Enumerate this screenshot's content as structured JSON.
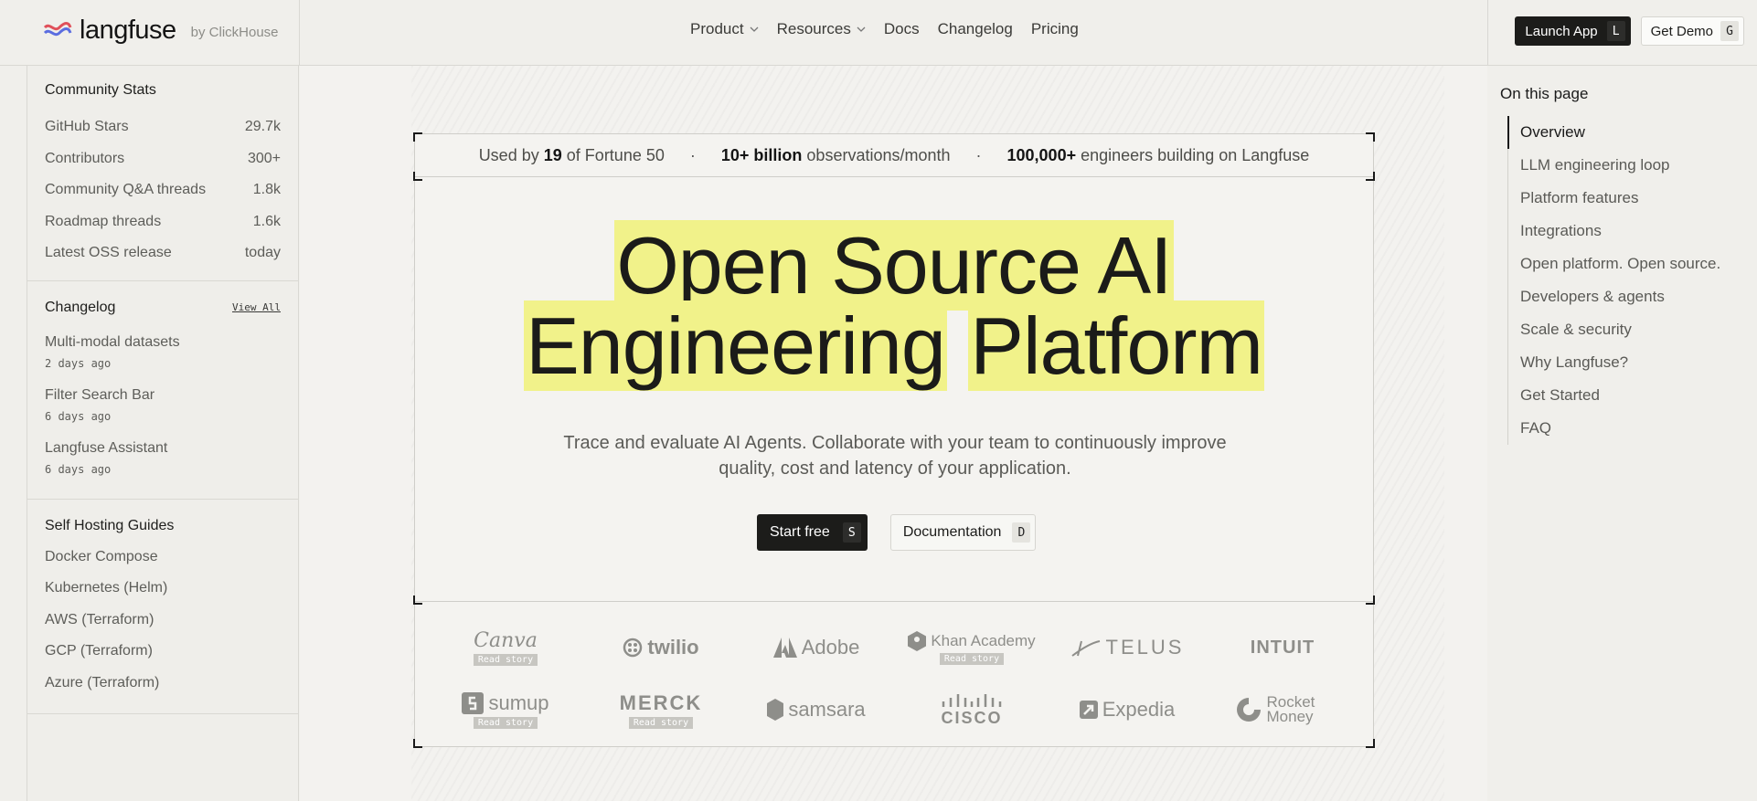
{
  "brand": {
    "name": "langfuse",
    "byline": "by ClickHouse"
  },
  "nav": {
    "items": [
      {
        "label": "Product",
        "dropdown": true
      },
      {
        "label": "Resources",
        "dropdown": true
      },
      {
        "label": "Docs",
        "dropdown": false
      },
      {
        "label": "Changelog",
        "dropdown": false
      },
      {
        "label": "Pricing",
        "dropdown": false
      }
    ],
    "launch": {
      "label": "Launch App",
      "key": "L"
    },
    "demo": {
      "label": "Get Demo",
      "key": "G"
    }
  },
  "sidebar": {
    "stats_title": "Community Stats",
    "stats": [
      {
        "label": "GitHub Stars",
        "value": "29.7k"
      },
      {
        "label": "Contributors",
        "value": "300+"
      },
      {
        "label": "Community Q&A threads",
        "value": "1.8k"
      },
      {
        "label": "Roadmap threads",
        "value": "1.6k"
      },
      {
        "label": "Latest OSS release",
        "value": "today"
      }
    ],
    "changelog_title": "Changelog",
    "changelog_viewall": "View All",
    "changelog": [
      {
        "title": "Multi-modal datasets",
        "date": "2 days ago"
      },
      {
        "title": "Filter Search Bar",
        "date": "6 days ago"
      },
      {
        "title": "Langfuse Assistant",
        "date": "6 days ago"
      }
    ],
    "guides_title": "Self Hosting Guides",
    "guides": [
      "Docker Compose",
      "Kubernetes (Helm)",
      "AWS (Terraform)",
      "GCP (Terraform)",
      "Azure (Terraform)"
    ]
  },
  "toc": {
    "title": "On this page",
    "items": [
      "Overview",
      "LLM engineering loop",
      "Platform features",
      "Integrations",
      "Open platform. Open source.",
      "Developers & agents",
      "Scale & security",
      "Why Langfuse?",
      "Get Started",
      "FAQ"
    ],
    "active_index": 0
  },
  "hero": {
    "stat1_pre": "Used by",
    "stat1_bold": "19",
    "stat1_post": "of Fortune 50",
    "stat2_bold": "10+ billion",
    "stat2_post": "observations/month",
    "stat3_bold": "100,000+",
    "stat3_post": "engineers building on Langfuse",
    "title_line1": "Open Source AI",
    "title_line2a": "Engineering",
    "title_line2b": "Platform",
    "subtitle": "Trace and evaluate AI Agents. Collaborate with your team to continuously improve quality, cost and latency of your application.",
    "cta_primary": {
      "label": "Start free",
      "key": "S"
    },
    "cta_secondary": {
      "label": "Documentation",
      "key": "D"
    }
  },
  "logos": [
    {
      "name": "Canva",
      "story": "Read story"
    },
    {
      "name": "twilio",
      "story": ""
    },
    {
      "name": "Adobe",
      "story": ""
    },
    {
      "name": "Khan Academy",
      "story": "Read story"
    },
    {
      "name": "TELUS",
      "story": ""
    },
    {
      "name": "INTUIT",
      "story": ""
    },
    {
      "name": "sumup",
      "story": "Read story"
    },
    {
      "name": "MERCK",
      "story": "Read story"
    },
    {
      "name": "samsara",
      "story": ""
    },
    {
      "name": "CISCO",
      "story": ""
    },
    {
      "name": "Expedia",
      "story": ""
    },
    {
      "name": "Rocket Money",
      "story": ""
    }
  ],
  "colors": {
    "highlight": "#f1f28a",
    "dark_button": "#1c1c1a",
    "background": "#f0efeb"
  }
}
